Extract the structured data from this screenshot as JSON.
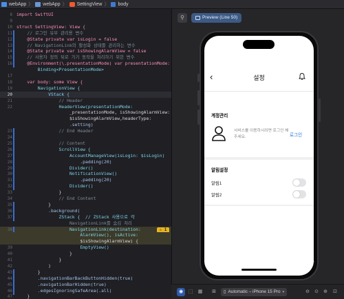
{
  "breadcrumbs": {
    "items": [
      {
        "label": "webApp",
        "icon": "app-icon"
      },
      {
        "label": "webApp",
        "icon": "folder-icon"
      },
      {
        "label": "SettingView",
        "icon": "swift-file-icon"
      },
      {
        "label": "body",
        "icon": "property-icon"
      }
    ],
    "separator": "〉"
  },
  "editor": {
    "lines": [
      {
        "n": "8",
        "t": "import SwiftUI"
      },
      {
        "n": "9",
        "t": ""
      },
      {
        "n": "10",
        "t": "struct SettingView: View {"
      },
      {
        "n": "11",
        "t": "    // 로그인 유무 관리용 변수"
      },
      {
        "n": "12",
        "t": "    @State private var isLogin = false"
      },
      {
        "n": "13",
        "t": "    // NavigationLink의 활성화 상태를 관리하는 변수"
      },
      {
        "n": "14",
        "t": "    @State private var isShowingAlarmView = false"
      },
      {
        "n": "15",
        "t": "    // 사용자 정의 뒤로 가기 동작을 처리하기 위한 변수"
      },
      {
        "n": "16",
        "t": "    @Environment(\\.presentationMode) var presentationMode:"
      },
      {
        "n": "",
        "t": "        Binding<PresentationMode>"
      },
      {
        "n": "17",
        "t": ""
      },
      {
        "n": "18",
        "t": "    var body: some View {"
      },
      {
        "n": "19",
        "t": "        NavigationView {"
      },
      {
        "n": "20",
        "t": "            VStack {"
      },
      {
        "n": "21",
        "t": "                // Header"
      },
      {
        "n": "22",
        "t": "                HeaderView(presentationMode:"
      },
      {
        "n": "",
        "t": "                    _presentationMode, isShowingAlarmView:"
      },
      {
        "n": "",
        "t": "                    $isShowingAlarmView,headerType:"
      },
      {
        "n": "",
        "t": "                    .setting)"
      },
      {
        "n": "23",
        "t": "                // End Header"
      },
      {
        "n": "24",
        "t": ""
      },
      {
        "n": "25",
        "t": "                // Content"
      },
      {
        "n": "26",
        "t": "                ScrollView {"
      },
      {
        "n": "27",
        "t": "                    AccountManageView(isLogin: $isLogin)"
      },
      {
        "n": "28",
        "t": "                        .padding(20)"
      },
      {
        "n": "29",
        "t": "                    Divider()"
      },
      {
        "n": "30",
        "t": "                    NotificationView()"
      },
      {
        "n": "31",
        "t": "                        .padding(20)"
      },
      {
        "n": "32",
        "t": "                    Divider()"
      },
      {
        "n": "33",
        "t": "                }"
      },
      {
        "n": "34",
        "t": "                // End Content"
      },
      {
        "n": "35",
        "t": "            }"
      },
      {
        "n": "36",
        "t": "            .background("
      },
      {
        "n": "37",
        "t": "                ZStack {  // ZStack 사용으로 각"
      },
      {
        "n": "",
        "t": "                    NavigationLink를 숨김 처리"
      },
      {
        "n": "38",
        "t": "                    NavigationLink(destination:"
      },
      {
        "n": "",
        "t": "                        AlarmView(), isActive:"
      },
      {
        "n": "",
        "t": "                        $isShowingAlarmView) {"
      },
      {
        "n": "39",
        "t": "                        EmptyView()"
      },
      {
        "n": "40",
        "t": "                    }"
      },
      {
        "n": "41",
        "t": "                }"
      },
      {
        "n": "42",
        "t": "            )"
      },
      {
        "n": "43",
        "t": "        }"
      },
      {
        "n": "44",
        "t": "        .navigationBarBackButtonHidden(true)"
      },
      {
        "n": "45",
        "t": "        .navigationBarHidden(true)"
      },
      {
        "n": "46",
        "t": "        .edgesIgnoringSafeArea(.all)"
      },
      {
        "n": "47",
        "t": "    }"
      }
    ],
    "warning_badge": "⚠ 1"
  },
  "canvas": {
    "pin_icon": "pin-icon",
    "preview_tab_label": "Preview (Line 50)"
  },
  "phone_app": {
    "nav_title": "설정",
    "back_icon": "chevron-left-icon",
    "bell_icon": "bell-icon",
    "account_section_title": "계정관리",
    "account_description": "서비스를 이용하시려면 로그인 해주세요.",
    "login_button": "로그인",
    "alarm_section_title": "알림설정",
    "alarms": [
      {
        "label": "알림1",
        "on": false
      },
      {
        "label": "알림2",
        "on": false
      }
    ]
  },
  "bottom_toolbar": {
    "device_label": "Automatic – iPhone 15 Pro",
    "zoom_icons": [
      "zoom-out-icon",
      "zoom-actual-icon",
      "zoom-in-icon",
      "zoom-fit-icon"
    ]
  },
  "colors": {
    "accent": "#2a7bd8",
    "editor_bg": "#1f1f24",
    "preview_tab": "#3d5a84"
  }
}
